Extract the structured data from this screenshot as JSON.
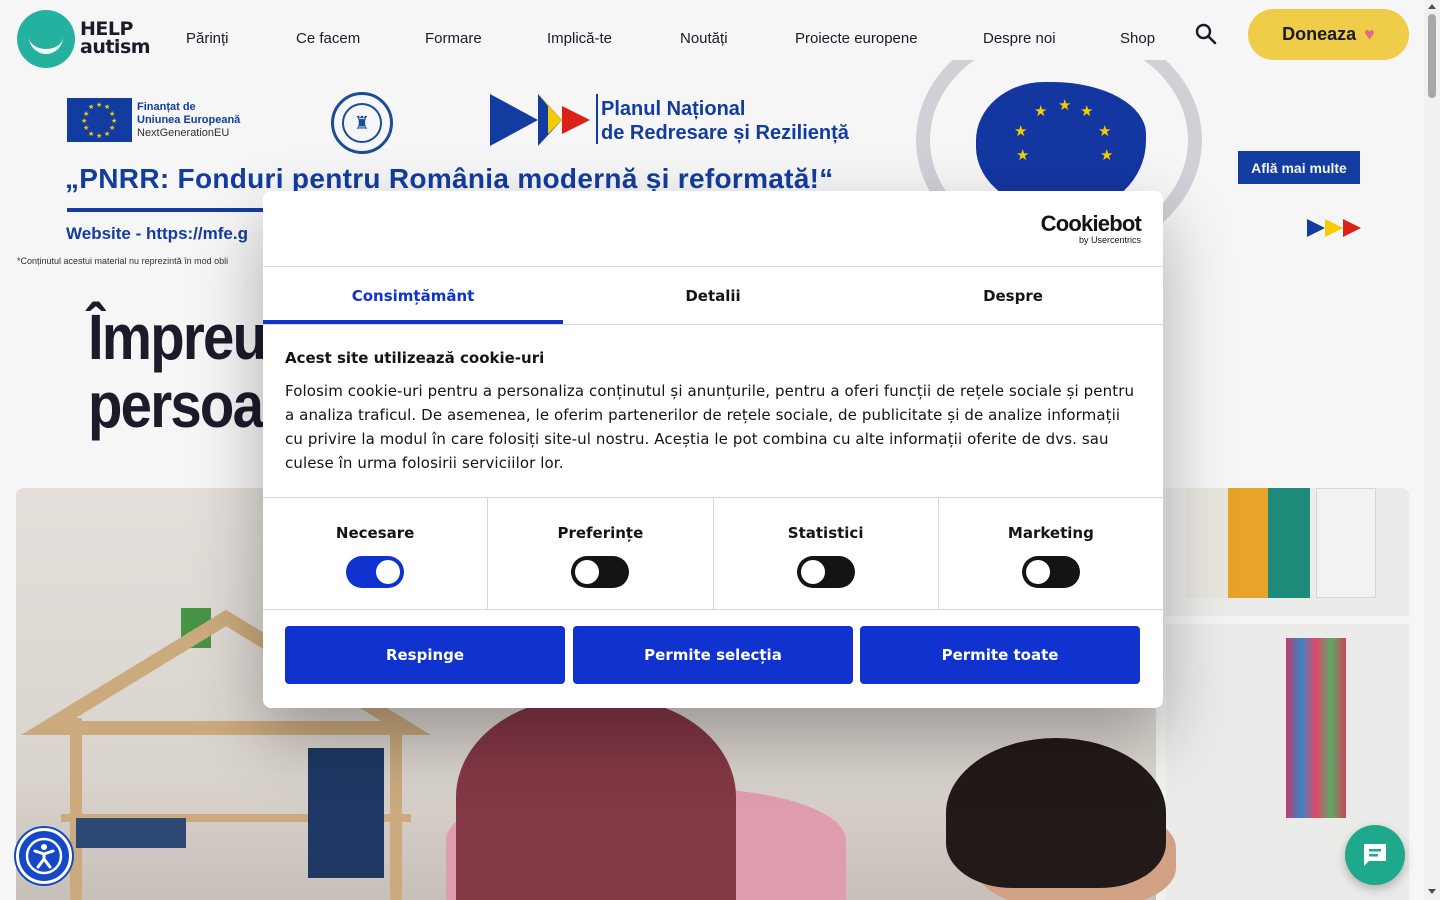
{
  "header": {
    "logo_line1": "HELP",
    "logo_line2": "autism",
    "nav": [
      "Părinți",
      "Ce facem",
      "Formare",
      "Implică-te",
      "Noutăți",
      "Proiecte europene",
      "Despre noi",
      "Shop"
    ],
    "donate_label": "Doneaza",
    "search_icon": "search-icon",
    "brand_color": "#25b8a5",
    "donate_color": "#f9d54a"
  },
  "banner": {
    "eu_line1": "Finanțat de",
    "eu_line2": "Uniunea Europeană",
    "eu_line3": "NextGenerationEU",
    "pnrr_line1": "Planul Național",
    "pnrr_line2": "de Redresare și Reziliență",
    "slogan": "„PNRR: Fonduri pentru România modernă și reformată!“",
    "website": "Website - https://mfe.g",
    "disclaimer": "*Conținutul acestui material nu reprezintă în mod obli",
    "learn_more": "Află mai multe",
    "accent_color": "#123ea6"
  },
  "hero": {
    "title_line1": "Împreu                                                         ntru",
    "title_line2": "persoa"
  },
  "cookie_dialog": {
    "brand_main": "Cookiebot",
    "brand_sub": "by Usercentrics",
    "tabs": [
      "Consimțământ",
      "Detalii",
      "Despre"
    ],
    "active_tab": "Consimțământ",
    "heading": "Acest site utilizează cookie-uri",
    "body": "Folosim cookie-uri pentru a personaliza conținutul și anunțurile, pentru a oferi funcții de rețele sociale și pentru a analiza traficul. De asemenea, le oferim partenerilor de rețele sociale, de publicitate și de analize informații cu privire la modul în care folosiți site-ul nostru. Aceștia le pot combina cu alte informații oferite de dvs. sau culese în urma folosirii serviciilor lor.",
    "categories": [
      {
        "label": "Necesare",
        "on": true
      },
      {
        "label": "Preferințe",
        "on": false
      },
      {
        "label": "Statistici",
        "on": false
      },
      {
        "label": "Marketing",
        "on": false
      }
    ],
    "buttons": [
      "Respinge",
      "Permite selecția",
      "Permite toate"
    ],
    "accent_color": "#1032cf"
  },
  "floating": {
    "accessibility_icon": "accessibility-icon",
    "chat_icon": "chat-icon"
  }
}
